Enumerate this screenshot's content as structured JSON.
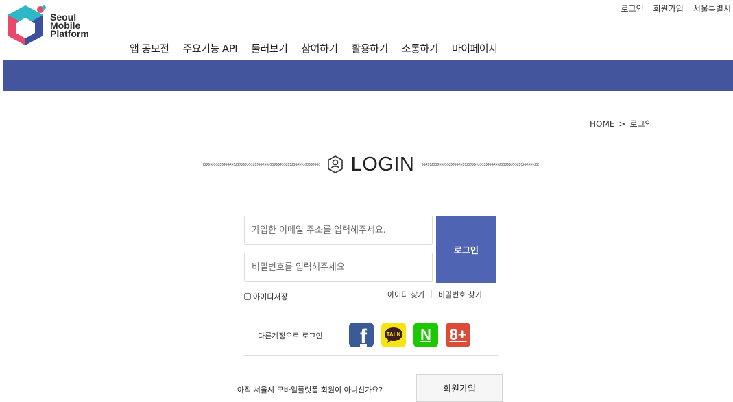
{
  "logo": {
    "line1": "Seoul",
    "line2": "Mobile",
    "line3": "Platform",
    "icon": "hexagon-logo-icon"
  },
  "util_nav": [
    "로그인",
    "회원가입",
    "서울특별시"
  ],
  "gnb": [
    "앱 공모전",
    "주요기능 API",
    "둘러보기",
    "참여하기",
    "활용하기",
    "소통하기",
    "마이페이지"
  ],
  "breadcrumb": {
    "home": "HOME",
    "separator": ">",
    "current": "로그인"
  },
  "title": {
    "text": "LOGIN",
    "icon": "user-hexagon-icon"
  },
  "form": {
    "email_placeholder": "가입한 이메일 주소를 입력해주세요.",
    "password_placeholder": "비밀번호를 입력해주세요",
    "login_label": "로그인",
    "remember_label": "아이디저장",
    "find_id": "아이디 찾기",
    "find_sep": "|",
    "find_pw": "비밀번호 찾기"
  },
  "social": {
    "label": "다른계정으로 로그인",
    "items": [
      {
        "name": "facebook",
        "icon": "facebook-icon",
        "glyph": "f"
      },
      {
        "name": "kakaotalk",
        "icon": "kakaotalk-icon",
        "glyph": "TALK"
      },
      {
        "name": "naver",
        "icon": "naver-icon",
        "glyph": "N"
      },
      {
        "name": "google-plus",
        "icon": "google-plus-icon",
        "glyph": "8+"
      }
    ]
  },
  "join": {
    "question": "아직 서울시 모바일플랫폼 회원이 아니신가요?",
    "button": "회원가입"
  },
  "colors": {
    "band": "#43559d",
    "login_button": "#5064b4",
    "facebook": "#3b5b98",
    "kakao": "#f6e312",
    "naver": "#1ec800",
    "google": "#dc4a38"
  }
}
